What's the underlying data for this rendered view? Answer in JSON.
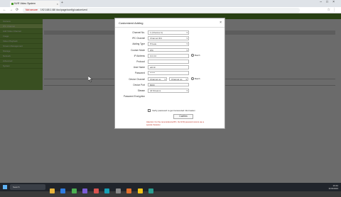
{
  "browser": {
    "tab_title": "NVR Video System",
    "url": "192.168.1.68/ doc/page/config/customized",
    "url_warning": "Not secure"
  },
  "modal": {
    "title": "Customized Adding",
    "fields": [
      {
        "label": "Channel No.",
        "value": "1 (Channel 1)"
      },
      {
        "label": "IPC Channel",
        "value": "Channel 001"
      },
      {
        "label": "Adding Type",
        "value": "Private"
      },
      {
        "label": "Custom Mode",
        "value": "IPC"
      },
      {
        "label": "IP Address",
        "value": "0.0.0.0",
        "radio": "Batch"
      },
      {
        "label": "Protocol",
        "value": ""
      },
      {
        "label": "User Name",
        "value": "admin"
      },
      {
        "label": "Password",
        "value": "******"
      },
      {
        "label": "Device Channel",
        "value_a": "Channel no.",
        "value_b": "Channel no.",
        "radio": "Batch"
      },
      {
        "label": "Device Port",
        "value": "8000"
      },
      {
        "label": "Stream",
        "value": "All Streams"
      },
      {
        "label": "Password Encryption",
        "value": ""
      }
    ],
    "checkbox_label": "Verify password to get transcoded information",
    "confirm_label": "Confirm",
    "warning": "Attention: For the camera/device/IPC, the NVR password cannot use a special character."
  },
  "sidebar": {
    "items": [
      "Camera",
      "IPC Channel",
      "Add Video Channel",
      "Image",
      "Video Playback",
      "Stream Management",
      "Storage",
      "Network",
      "Advanced",
      "System"
    ]
  },
  "taskbar": {
    "search_placeholder": "Search",
    "time": "10:42",
    "date": "3/15/2023"
  },
  "colors": {
    "brand_green": "#5a8c2a",
    "warning_red": "#c0392b"
  }
}
